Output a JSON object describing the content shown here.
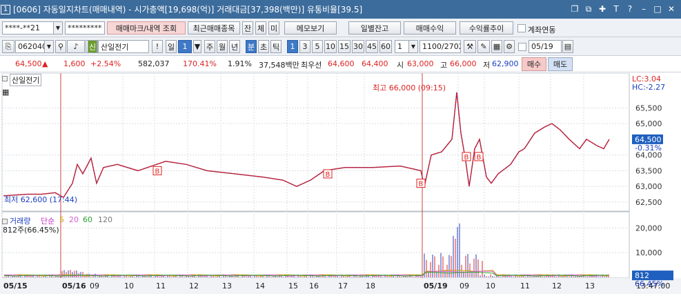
{
  "title": {
    "num": "1",
    "text": "[0606] 자동일지차트(매매내역) - 시가총액[19,698(억)] 거래대금[37,398(백만)] 유통비율[39.5]",
    "icons": [
      "restore-icon",
      "copy-icon",
      "pin-icon",
      "font-size-icon",
      "help-icon",
      "minimize-icon",
      "maximize-icon",
      "close-icon"
    ]
  },
  "toolbar1": {
    "account": "****-**21",
    "password": "*********",
    "trade_mark_btn": "매매마크/내역 조회",
    "recent_btn": "최근매매종목",
    "tab_jan": "잔",
    "tab_che": "체",
    "tab_mi": "미",
    "memo_btn": "메모보기",
    "daily_btn": "일별잔고",
    "profit_btn": "매매수익",
    "profit_rate_btn": "수익률추이",
    "link_label": "계좌연동"
  },
  "toolbar2": {
    "code": "062040",
    "sin_badge": "신",
    "stock_name": "산일전기",
    "exclaim": "!",
    "period_day": "일",
    "period_num": "1",
    "period_week": "주",
    "period_month": "월",
    "period_year": "년",
    "period_min": "분",
    "period_cho": "초",
    "period_tick": "틱",
    "intervals": [
      "1",
      "3",
      "5",
      "10",
      "15",
      "30",
      "45",
      "60"
    ],
    "interval_val": "1",
    "count": "1100/2702",
    "date": "05/19"
  },
  "quote": {
    "price": "64,500",
    "arrow": "▲",
    "change": "1,600",
    "change_pct": "+2.54%",
    "volume": "582,037",
    "vol_ratio": "170.41%",
    "turnover": "1.91%",
    "amount": "37,548백만",
    "best_label": "최우선",
    "ask": "64,600",
    "bid": "64,400",
    "open_label": "시",
    "open": "63,000",
    "high_label": "고",
    "high": "66,000",
    "low_label": "저",
    "low": "62,900",
    "buy_btn": "매수",
    "sell_btn": "매도"
  },
  "chart": {
    "stock_label": "산일전기",
    "lc": "LC:3.04",
    "hc": "HC:-2.27",
    "high_annot": "최고 66,000 (09:15)",
    "low_annot": "최저 62,600 (17:44)",
    "price_axis": [
      "65,500",
      "65,000",
      "64,000",
      "63,500",
      "63,000",
      "62,500"
    ],
    "current_price": "64,500",
    "current_pct": "-0.31%",
    "mark_b": "B",
    "volume_title": "거래량",
    "ma_label": "단순",
    "ma_periods": [
      "5",
      "20",
      "60",
      "120"
    ],
    "volume_sub": "812주(66.45%)",
    "vol_axis": [
      "20,000",
      "10,000"
    ],
    "vol_current": "812",
    "vol_pct": "66.45%",
    "time_labels": [
      "05/15",
      "05/16",
      "09",
      "10",
      "11",
      "12",
      "13",
      "14",
      "15",
      "16",
      "17",
      "18",
      "05/19",
      "09",
      "10",
      "11",
      "12",
      "13"
    ],
    "clock": "13:47:00",
    "colors": {
      "up": "#e02020",
      "down": "#1f3fbf",
      "ma5": "#d0a000",
      "ma20": "#d060d0",
      "ma60": "#30a030",
      "grid": "#d8dde3"
    }
  },
  "chart_data": {
    "type": "line",
    "price_range": [
      62300,
      66300
    ],
    "volume_range": [
      0,
      24000
    ],
    "note": ""
  }
}
